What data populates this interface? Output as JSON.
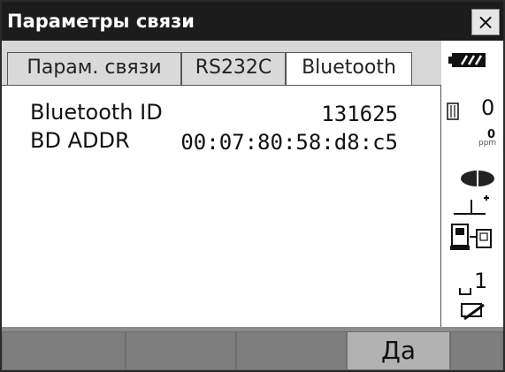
{
  "window": {
    "title": "Параметры связи",
    "close_label": "×"
  },
  "tabs": [
    {
      "label": "Парам. связи"
    },
    {
      "label": "RS232C"
    },
    {
      "label": "Bluetooth"
    }
  ],
  "fields": {
    "bluetooth_id": {
      "label": "Bluetooth ID",
      "value": "131625"
    },
    "bd_addr": {
      "label": "BD ADDR",
      "value": "00:07:80:58:d8:c5"
    }
  },
  "status": {
    "prism_constant": "0",
    "ppm_value": "0",
    "ppm_unit": "ppm",
    "mode_number": "1"
  },
  "softkeys": [
    {
      "label": ""
    },
    {
      "label": ""
    },
    {
      "label": ""
    },
    {
      "label": "Да"
    },
    {
      "label": ""
    }
  ]
}
